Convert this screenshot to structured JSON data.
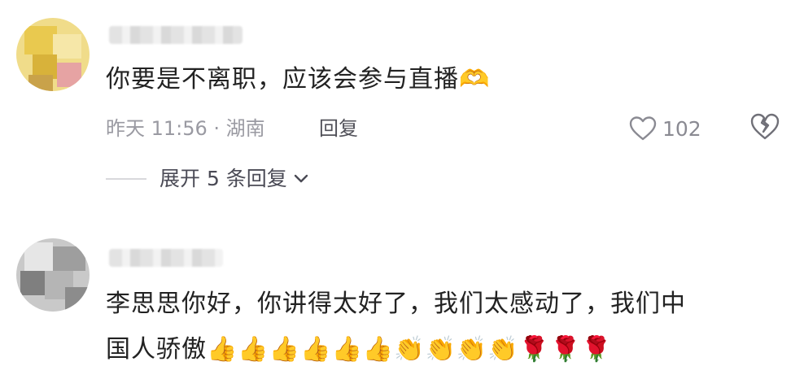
{
  "comments": [
    {
      "text": "你要是不离职，应该会参与直播",
      "emojis": [
        "🫶"
      ],
      "time": "昨天 11:56 · 湖南",
      "reply_label": "回复",
      "like_count": "102",
      "expand_label": "展开 5 条回复",
      "icons": [
        "heart-outline-icon",
        "broken-heart-icon",
        "chevron-down-icon"
      ]
    },
    {
      "line1": "李思思你好，你讲得太好了，我们太感动了，我们中",
      "line2": "国人骄傲",
      "emojis": [
        "👍",
        "👍",
        "👍",
        "👍",
        "👍",
        "👍",
        "👏",
        "👏",
        "👏",
        "👏",
        "🌹",
        "🌹",
        "🌹"
      ]
    }
  ],
  "colors": {
    "text": "#222222",
    "meta": "#9a9aa2",
    "reply": "#505058"
  }
}
